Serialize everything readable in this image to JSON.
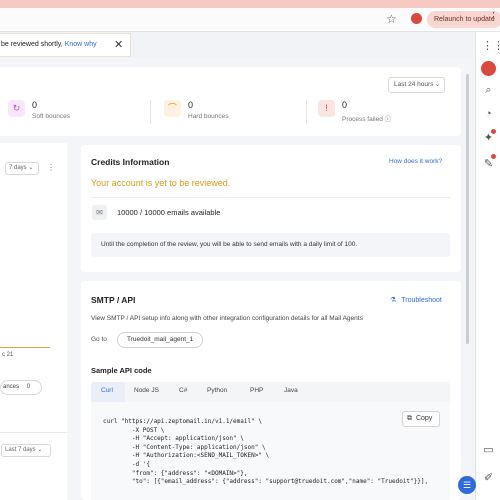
{
  "browser": {
    "relaunch_label": "Relaunch to update",
    "star_icon": "star-icon",
    "menu_icon": "kebab-menu-icon"
  },
  "notification": {
    "text": "be reviewed shortly,",
    "link": "Know why",
    "close": "✕"
  },
  "stats": {
    "range": "Last 24 hours",
    "items": [
      {
        "value": "0",
        "label": "Soft bounces",
        "icon": "refresh-icon",
        "color": "#c14fcb"
      },
      {
        "value": "0",
        "label": "Hard bounces",
        "icon": "bounce-icon",
        "color": "#e08a1e"
      },
      {
        "value": "0",
        "label": "Process failed",
        "icon": "alert-icon",
        "color": "#d9493d"
      }
    ]
  },
  "left_panel": {
    "range_top": "7 days",
    "range_bottom": "Last 7 days",
    "date_text": "c 21",
    "bounces_label": "ances",
    "bounces_value": "0"
  },
  "credits": {
    "title": "Credits Information",
    "help_link": "How does it work?",
    "warning": "Your account is yet to be reviewed.",
    "emails": "10000 / 10000 emails available",
    "info": "Until the completion of the review, you will be able to send emails with a daily limit of 100."
  },
  "smtp": {
    "title": "SMTP / API",
    "troubleshoot": "Troubleshoot",
    "description": "View SMTP / API setup info along with other integration configuration details for all Mail Agents",
    "goto_label": "Go to",
    "agent": "Truedoit_mail_agent_1",
    "sample_title": "Sample API code",
    "tabs": [
      "Curl",
      "Node JS",
      "C#",
      "Python",
      "PHP",
      "Java"
    ],
    "copy_label": "Copy",
    "code": "curl \"https://api.zeptomail.in/v1.1/email\" \\\n        -X POST \\\n        -H \"Accept: application/json\" \\\n        -H \"Content-Type: application/json\" \\\n        -H \"Authorization:<SEND_MAIL_TOKEN>\" \\\n        -d '{\n        \"from\": {\"address\": \"<DOMAIN>\"},\n        \"to\": [{\"email_address\": {\"address\": \"support@truedoit.com\",\"name\": \"Truedoit\"}}],"
  }
}
